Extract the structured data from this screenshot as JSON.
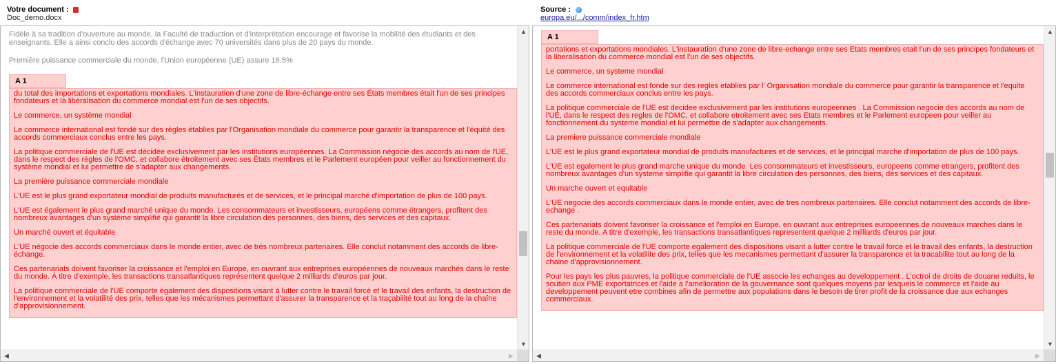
{
  "header_left": {
    "title": "Votre document :",
    "filename": "Doc_demo.docx"
  },
  "header_right": {
    "title": "Source :",
    "link": "europa.eu/.../comm/index_fr.htm"
  },
  "left": {
    "intro1": "Fidèle à sa tradition d'ouverture au monde, la Faculté de traduction et d'interprétation encourage et favorise la mobilité des étudiants et des enseignants. Elle a ainsi conclu des accords d'échange avec 70 universités dans plus de 20 pays du monde.",
    "intro2": "Première puissance commerciale du monde, l'Union européenne (UE) assure 16.5%",
    "block_label": "A 1",
    "paragraphs": [
      "du total des importations et exportations mondiales. L'instauration d'une zone de libre-échange entre ses États membres était l'un de ses principes fondateurs et la libéralisation du commerce mondial est l'un de ses objectifs.",
      "Le commerce, un système mondial",
      "Le commerce international est fondé sur des règles établies par l'Organisation mondiale du commerce pour garantir la transparence et l'équité des accords commerciaux conclus entre les pays.",
      "La politique commerciale de l'UE est décidée exclusivement par les institutions européennes. La Commission négocie des accords au nom de l'UE, dans le respect des règles de l'OMC, et collabore étroitement avec ses États membres et le Parlement européen pour veiller au fonctionnement du système mondial et lui permettre de s'adapter aux changements.",
      "La première puissance commerciale mondiale",
      "L'UE est le plus grand exportateur mondial de produits manufacturés et de services, et le principal marché d'importation de plus de 100 pays.",
      "L'UE est également le plus grand marché unique du monde. Les consommateurs et investisseurs, européens comme étrangers, profitent des nombreux avantages d'un système simplifié qui garantit la libre circulation des personnes, des biens, des services et des capitaux.",
      "Un marché ouvert et équitable",
      "L'UE négocie des accords commerciaux dans le monde entier, avec de très nombreux partenaires. Elle conclut notamment des accords de libre-échange.",
      "Ces partenariats doivent favoriser la croissance et l'emploi en Europe, en ouvrant aux entreprises européennes de nouveaux marchés dans le reste du monde. À titre d'exemple, les transactions transatlantiques représentent quelque 2 milliards d'euros par jour.",
      "La politique commerciale de l'UE comporte également des dispositions visant à lutter contre le travail forcé et le travail des enfants, la destruction de l'environnement et la volatilité des prix, telles que les mécanismes permettant d'assurer la transparence et la traçabilité tout au long de la chaîne d'approvisionnement."
    ]
  },
  "right": {
    "block_label": "A 1",
    "paragraphs": [
      "portations et exportations mondiales. L'instauration d'une zone de libre-echange entre ses Etats membres etait l'un de ses principes fondateurs et la liberalisation du commerce mondial est l'un de ses objectifs.",
      "Le commerce, un systeme mondial",
      "Le commerce international est fonde sur des regles etablies par l' Organisation mondiale du commerce pour garantir la transparence et l'equite des accords commerciaux conclus entre les pays.",
      "La politique commerciale de l'UE est decidee exclusivement par les institutions europeennes . La Commission negocie des accords au nom de l'UE, dans le respect des regles de l'OMC, et collabore etroitement avec ses Etats membres et le Parlement europeen pour veiller au fonctionnement du systeme mondial et lui permettre de s'adapter aux changements.",
      "La premiere puissance commerciale mondiale",
      "L'UE est le plus grand exportateur mondial de produits manufactures et de services, et le principal marche d'importation de plus de 100 pays.",
      "L'UE est egalement le plus grand marche unique du monde. Les consommateurs et investisseurs, europeens comme etrangers, profitent des nombreux avantages d'un systeme simplifie qui garantit la libre circulation des personnes, des biens, des services et des capitaux.",
      "Un marche ouvert et equitable",
      "L'UE negocie des accords commerciaux dans le monde entier, avec de tres nombreux partenaires. Elle conclut notamment des accords de libre-echange .",
      "Ces partenariats doivent favoriser la croissance et l'emploi en Europe, en ouvrant aux entreprises europeennes de nouveaux marches dans le reste du monde. A titre d'exemple, les transactions transatlantiques representent quelque 2 milliards d'euros par jour.",
      "La politique commerciale de l'UE comporte egalement des dispositions visant a lutter contre le travail force et le travail des enfants, la destruction de l'environnement et la volatilite des prix, telles que les mecanismes permettant d'assurer la transparence et la tracabilite tout au long de la chaine d'approvisionnement.",
      "Pour les pays les plus pauvres, la politique commerciale de l'UE associe les echanges au developpement . L'octroi de droits de douane reduits, le soutien aux PME exportatrices et l'aide a l'amelioration de la gouvernance sont quelques moyens par lesquels le commerce et l'aide au developpement peuvent etre combines afin de permettre aux populations dans le besoin de tirer profit de la croissance due aux echanges commerciaux."
    ]
  },
  "icons": {
    "left_header": "word-doc-icon",
    "right_header": "globe-icon"
  },
  "colors": {
    "match_bg": "#ffd0d0",
    "match_text": "#e60000",
    "intro_text": "#888888",
    "link": "#1a1aa6"
  }
}
